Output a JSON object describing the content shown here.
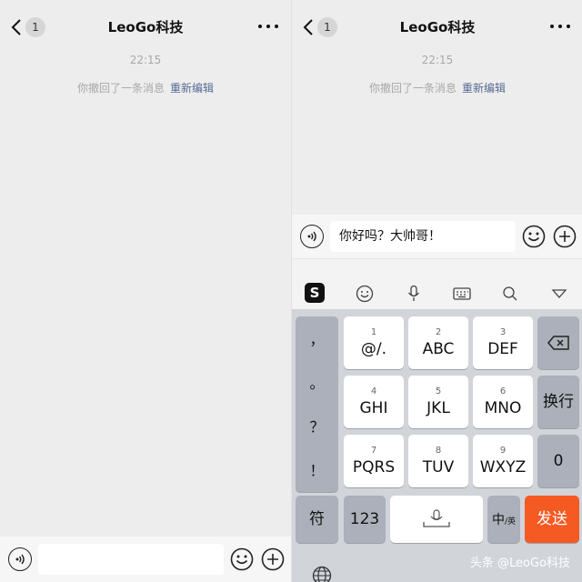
{
  "left": {
    "nav": {
      "back_badge": "1",
      "title": "LeoGo科技"
    },
    "time": "22:15",
    "system_msg": {
      "text": "你撤回了一条消息",
      "edit": "重新编辑"
    },
    "input": {
      "value": ""
    }
  },
  "right": {
    "nav": {
      "back_badge": "1",
      "title": "LeoGo科技"
    },
    "time": "22:15",
    "system_msg": {
      "text": "你撤回了一条消息",
      "edit": "重新编辑"
    },
    "input": {
      "value": "你好吗？大帅哥！"
    },
    "ime_toolbar": {
      "logo": "S",
      "icons": [
        "emoji-icon",
        "mic-icon",
        "keyboard-icon",
        "search-icon",
        "collapse-icon"
      ]
    },
    "keyboard": {
      "punctuation": [
        "，",
        "。",
        "？",
        "！"
      ],
      "keys": [
        {
          "num": "1",
          "label": "@/."
        },
        {
          "num": "2",
          "label": "ABC"
        },
        {
          "num": "3",
          "label": "DEF"
        },
        {
          "num": "4",
          "label": "GHI"
        },
        {
          "num": "5",
          "label": "JKL"
        },
        {
          "num": "6",
          "label": "MNO"
        },
        {
          "num": "7",
          "label": "PQRS"
        },
        {
          "num": "8",
          "label": "TUV"
        },
        {
          "num": "9",
          "label": "WXYZ"
        }
      ],
      "newline": "换行",
      "zero": "0",
      "symbols": "符",
      "num123": "123",
      "lang": "中",
      "lang_sub": "/英",
      "send": "发送"
    },
    "watermark": "头条 @LeoGo科技"
  },
  "colors": {
    "accent_link": "#576b95",
    "send": "#f45a22",
    "background": "#ededed"
  }
}
